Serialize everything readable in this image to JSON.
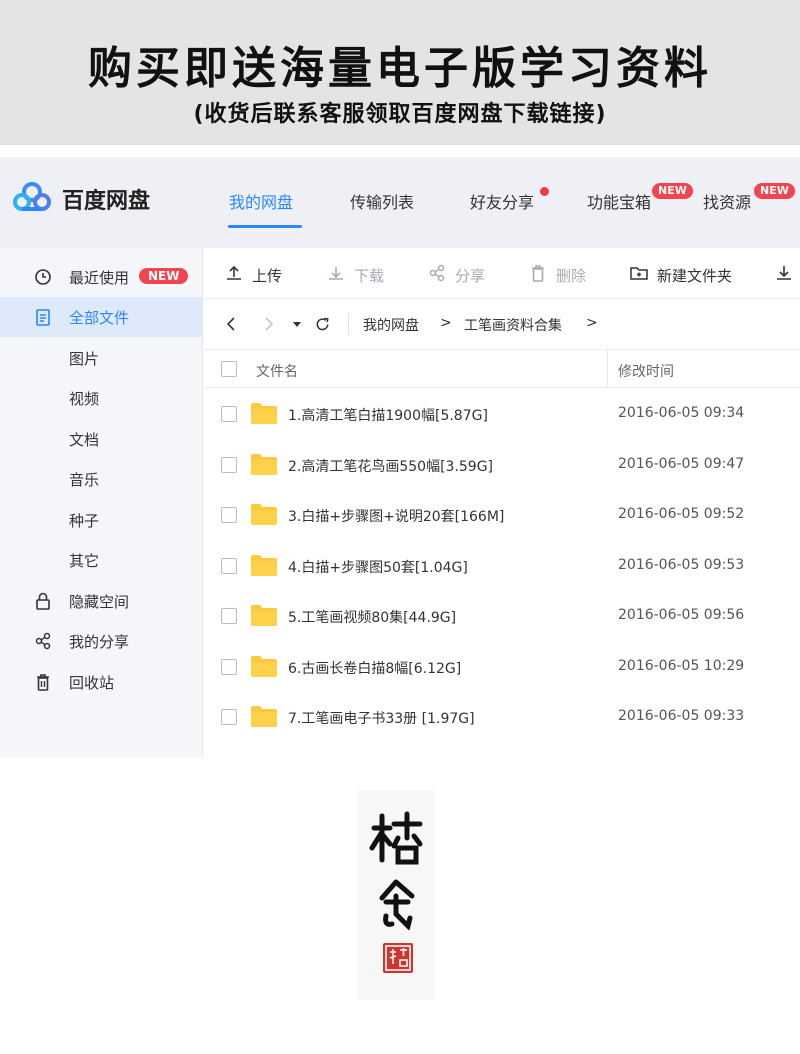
{
  "banner": {
    "title": "购买即送海量电子版学习资料",
    "subtitle": "(收货后联系客服领取百度网盘下载链接)"
  },
  "app": {
    "name": "百度网盘",
    "brand_color": "#2a87ff"
  },
  "nav": {
    "tabs": [
      {
        "label": "我的网盘"
      },
      {
        "label": "传输列表"
      },
      {
        "label": "好友分享"
      },
      {
        "label": "功能宝箱"
      },
      {
        "label": "找资源"
      }
    ],
    "badge": "NEW"
  },
  "sidebar": {
    "badge": "NEW",
    "items": [
      {
        "label": "最近使用",
        "icon": "clock-icon"
      },
      {
        "label": "全部文件",
        "icon": "document-icon"
      },
      {
        "label": "图片"
      },
      {
        "label": "视频"
      },
      {
        "label": "文档"
      },
      {
        "label": "音乐"
      },
      {
        "label": "种子"
      },
      {
        "label": "其它"
      },
      {
        "label": "隐藏空间",
        "icon": "lock-icon"
      },
      {
        "label": "我的分享",
        "icon": "share-icon"
      },
      {
        "label": "回收站",
        "icon": "trash-icon"
      }
    ]
  },
  "toolbar": {
    "upload": "上传",
    "download": "下载",
    "share": "分享",
    "delete": "删除",
    "new_folder": "新建文件夹"
  },
  "breadcrumb": {
    "root": "我的网盘",
    "sep": ">",
    "current": "工笔画资料合集",
    "tail": ">"
  },
  "table": {
    "columns": {
      "name": "文件名",
      "modified": "修改时间"
    },
    "rows": [
      {
        "name": "1.高清工笔白描1900幅[5.87G]",
        "modified": "2016-06-05 09:34"
      },
      {
        "name": "2.高清工笔花鸟画550幅[3.59G]",
        "modified": "2016-06-05 09:47"
      },
      {
        "name": "3.白描+步骤图+说明20套[166M]",
        "modified": "2016-06-05 09:52"
      },
      {
        "name": "4.白描+步骤图50套[1.04G]",
        "modified": "2016-06-05 09:53"
      },
      {
        "name": "5.工笔画视频80集[44.9G]",
        "modified": "2016-06-05 09:56"
      },
      {
        "name": "6.古画长卷白描8幅[6.12G]",
        "modified": "2016-06-05 10:29"
      },
      {
        "name": "7.工笔画电子书33册 [1.97G]",
        "modified": "2016-06-05 09:33"
      }
    ]
  },
  "seal": {
    "calligraphy": "桔舍",
    "stamp": "桔舍"
  }
}
